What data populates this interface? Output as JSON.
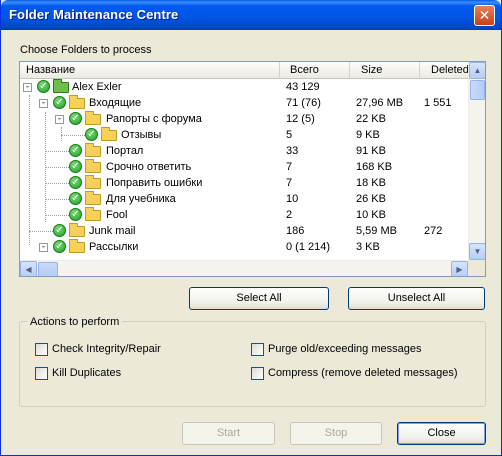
{
  "window": {
    "title": "Folder Maintenance Centre",
    "close_glyph": "✕"
  },
  "choose_label": "Choose Folders to process",
  "columns": {
    "name": "Название",
    "total": "Всего",
    "size": "Size",
    "deleted": "Deleted"
  },
  "rows": [
    {
      "name": "Alex Exler",
      "total": "43 129",
      "size": "",
      "deleted": ""
    },
    {
      "name": "Входящие",
      "total": "71 (76)",
      "size": "27,96 MB",
      "deleted": "1 551"
    },
    {
      "name": "Рапорты с форума",
      "total": "12 (5)",
      "size": "22 KB",
      "deleted": ""
    },
    {
      "name": "Отзывы",
      "total": "5",
      "size": "9 KB",
      "deleted": ""
    },
    {
      "name": "Портал",
      "total": "33",
      "size": "91 KB",
      "deleted": ""
    },
    {
      "name": "Срочно ответить",
      "total": "7",
      "size": "168 KB",
      "deleted": ""
    },
    {
      "name": "Поправить ошибки",
      "total": "7",
      "size": "18 KB",
      "deleted": ""
    },
    {
      "name": "Для учебника",
      "total": "10",
      "size": "26 KB",
      "deleted": ""
    },
    {
      "name": "Fool",
      "total": "2",
      "size": "10 KB",
      "deleted": ""
    },
    {
      "name": "Junk mail",
      "total": "186",
      "size": "5,59 MB",
      "deleted": "272"
    },
    {
      "name": "Рассылки",
      "total": "0 (1 214)",
      "size": "3 KB",
      "deleted": ""
    }
  ],
  "buttons": {
    "select_all": "Select All",
    "unselect_all": "Unselect All",
    "start": "Start",
    "stop": "Stop",
    "close": "Close"
  },
  "actions": {
    "title": "Actions to perform",
    "check_integrity": "Check Integrity/Repair",
    "kill_duplicates": "Kill Duplicates",
    "purge_old": "Purge old/exceeding messages",
    "compress": "Compress (remove deleted messages)"
  }
}
